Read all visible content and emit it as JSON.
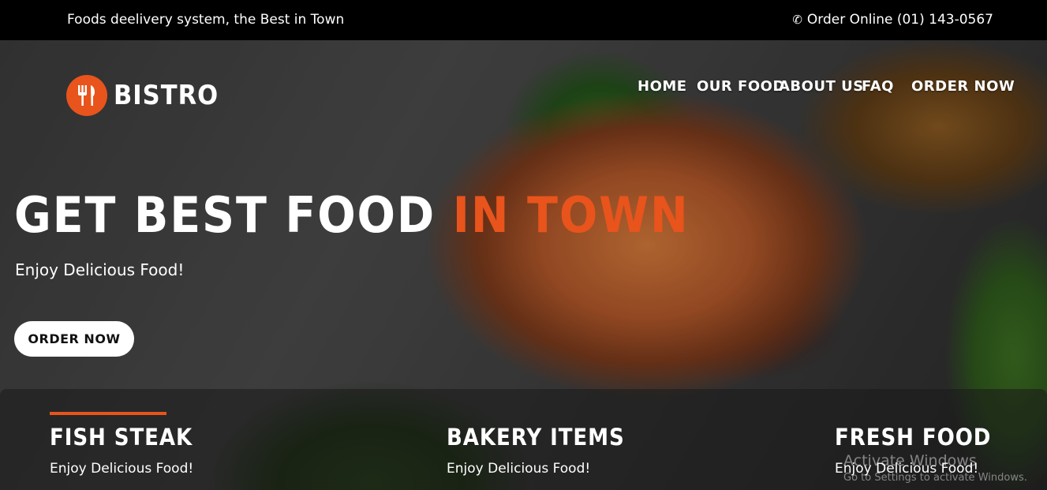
{
  "topbar": {
    "tagline": "Foods deelivery system, the Best in Town",
    "order_text": "Order Online (01) 143-0567",
    "phone_icon": "phone-icon"
  },
  "brand": {
    "name": "BISTRO",
    "logo_icon": "fork-knife-icon",
    "accent_color": "#e8541c"
  },
  "nav": {
    "items": [
      "HOME",
      "OUR FOOD",
      "ABOUT US",
      "FAQ",
      "ORDER NOW"
    ]
  },
  "hero": {
    "headline_main": "GET BEST FOOD",
    "headline_accent": "IN TOWN",
    "subheading": "Enjoy Delicious Food!",
    "cta_label": "ORDER NOW"
  },
  "features": [
    {
      "title": "FISH STEAK",
      "text": "Enjoy Delicious Food!"
    },
    {
      "title": "BAKERY ITEMS",
      "text": "Enjoy Delicious Food!"
    },
    {
      "title": "FRESH FOOD",
      "text": "Enjoy Delicious Food!"
    }
  ],
  "watermark": {
    "title": "Activate Windows",
    "subtitle": "Go to Settings to activate Windows."
  }
}
